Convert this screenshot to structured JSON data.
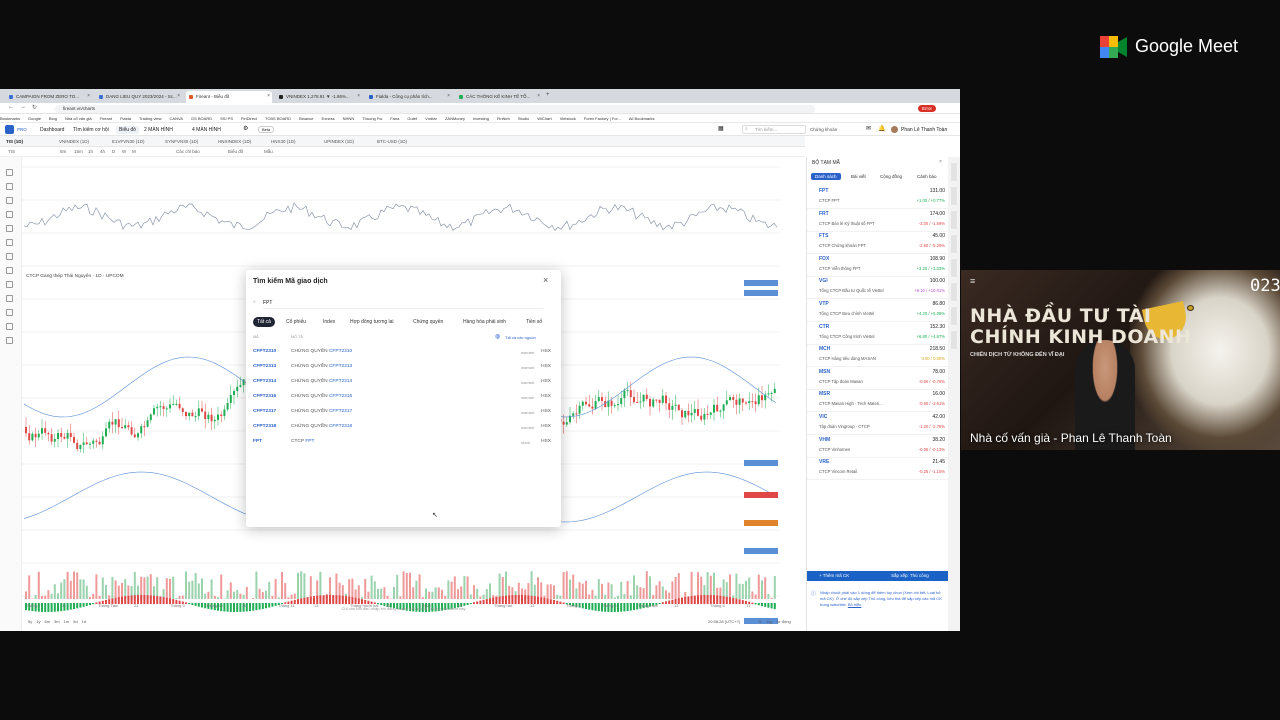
{
  "meet": {
    "brand": "Google Meet"
  },
  "browser": {
    "tabs": [
      {
        "label": "CAMPAIGN FROM ZERO TO..."
      },
      {
        "label": "DANG LIEU QUY 2023/2024 - Sc..."
      },
      {
        "label": "Fireant - Biểu đồ"
      },
      {
        "label": "VNINDEX 1,278.91 ▼ -1.86%..."
      },
      {
        "label": "Fialda - Công cụ phân tích..."
      },
      {
        "label": "CÁC THÔNG KẾ KINH TẾ TỔ..."
      }
    ],
    "url": "fireant.vn/charts",
    "error_btn": "Error",
    "bookmarks": [
      "Bookmarks",
      "Google",
      "Blog",
      "Nhà cổ vấn già",
      "Fireant",
      "Fialda",
      "Trading view",
      "CANVA",
      "GS BOARD",
      "SSI PS",
      "FinDirect",
      "TCBS BOARD",
      "Binance",
      "Exness",
      "NHNN",
      "Thuong Fw",
      "Fana",
      "Gutef",
      "Vndtar",
      "ZANMoney",
      "Investing",
      "FinNeh",
      "Studio",
      "WiChart",
      "Vietstock",
      "Forex Factory | For...",
      "All Bookmarks"
    ]
  },
  "app": {
    "logo": "PRO",
    "nav": [
      "Dashboard",
      "Tìm kiếm cơ hội",
      "Biểu đồ",
      "2 MÀN HÌNH",
      "4 MÀN HÌNH",
      "Beta"
    ],
    "search_placeholder": "Tìm kiếm...",
    "search_scope": "Chứng khoán",
    "user": "Phan Lê Thanh Toàn",
    "chart_tabs": [
      "TIS (1D)",
      "VNINDEX (1D)",
      "E1VFVN30 (1D)",
      "SYNFVN30 (1D)",
      "HNXINDEX (1D)",
      "HNX30 (1D)",
      "UPINDEX (1D)",
      "BTC-USD (1D)"
    ],
    "chart_tools": [
      "TIS",
      "5m",
      "15m",
      "1h",
      "4h",
      "D",
      "W",
      "M",
      "Các chỉ báo",
      "Biểu đồ",
      "Mẫu"
    ],
    "chart_title": "CTCP Gang thép Thái Nguyên · 1D · UPCOM",
    "x_labels": [
      "Tháng 7",
      "11",
      "Tháng Tám",
      "21",
      "Tháng 9",
      "Tháng 10",
      "16",
      "Tháng 11",
      "13",
      "Tháng mười hai",
      "11",
      "2024",
      "16",
      "Tháng hai",
      "13",
      "Tháng 3",
      "Tháng 4",
      "Tháng năm",
      "13",
      "Tháng 6",
      "17"
    ],
    "time_footer": "20:58:28 (UTC+7)",
    "footer_right": [
      "%",
      "log",
      "tự động"
    ],
    "periods": [
      "5y",
      "1y",
      "6m",
      "3m",
      "1m",
      "5d",
      "1d"
    ]
  },
  "watchlist": {
    "title": "BỘ TẠM MÃ",
    "tabs": [
      "Danh sách",
      "Bài viết",
      "Cộng đồng",
      "Cảnh báo"
    ],
    "items": [
      {
        "sym": "FPT",
        "name": "CTCP FPT",
        "price": "131.00",
        "chg": "+1.00 / +0.77%",
        "color": "#1fae55"
      },
      {
        "sym": "FRT",
        "name": "CTCP Bán lẻ Kỹ thuật số FPT",
        "price": "174.00",
        "chg": "-3.00 / -1.69%",
        "color": "#e04848"
      },
      {
        "sym": "FTS",
        "name": "CTCP Chứng khoán FPT",
        "price": "45.00",
        "chg": "-2.50 / -5.26%",
        "color": "#e04848"
      },
      {
        "sym": "FOX",
        "name": "CTCP Viễn thông FPT",
        "price": "108.90",
        "chg": "+3.20 / +3.03%",
        "color": "#1fae55"
      },
      {
        "sym": "VGI",
        "name": "Tổng CTCP Đầu tư Quốc tế Viettel",
        "price": "100.00",
        "chg": "+9.10 / +10.01%",
        "color": "#b84fd6"
      },
      {
        "sym": "VTP",
        "name": "Tổng CTCP Bưu chính Viettel",
        "price": "86.80",
        "chg": "+4.20 / +5.08%",
        "color": "#1fae55"
      },
      {
        "sym": "CTR",
        "name": "Tổng CTCP Công trình Viettel",
        "price": "152.30",
        "chg": "+6.80 / +4.67%",
        "color": "#1fae55"
      },
      {
        "sym": "MCH",
        "name": "CTCP Hàng tiêu dùng MASAN",
        "price": "218.50",
        "chg": "0.00 / 0.00%",
        "color": "#d6a51c"
      },
      {
        "sym": "MSN",
        "name": "CTCP Tập đoàn Masan",
        "price": "78.00",
        "chg": "-0.60 / -0.76%",
        "color": "#e04848"
      },
      {
        "sym": "MSR",
        "name": "CTCP Masan High - Tech Materi...",
        "price": "16.00",
        "chg": "-0.60 / -3.61%",
        "color": "#e04848"
      },
      {
        "sym": "VIC",
        "name": "Tập đoàn Vingroup - CTCP",
        "price": "42.00",
        "chg": "-1.20 / -2.78%",
        "color": "#e04848"
      },
      {
        "sym": "VHM",
        "name": "CTCP Vinhomes",
        "price": "38.20",
        "chg": "-0.05 / -0.13%",
        "color": "#e04848"
      },
      {
        "sym": "VRE",
        "name": "CTCP Vincom Retail",
        "price": "21.45",
        "chg": "-0.25 / -1.15%",
        "color": "#e04848"
      }
    ],
    "add_btn": "+ Thêm mã CK",
    "sort_btn": "Sắp xếp: Thủ công",
    "hint": "Nhấp chuột phải vào 1 dòng để thêm tùy chọn (Xem chi tiết, Loại bỏ mã CK). Ở chế độ sắp xếp Thủ công, kéo thả để sắp xếp các mã CK trong watchlist.",
    "hint_link": "Bỏ hiểu"
  },
  "modal": {
    "title": "Tìm kiếm Mã giao dịch",
    "query": "FPT",
    "filters": [
      "Tất cả",
      "Cổ phiếu",
      "Index",
      "Hợp đồng tương lai",
      "Chứng quyền",
      "Hàng hóa phái sinh",
      "Tiền số"
    ],
    "col_sym": "MÃ",
    "col_desc": "MÔ TẢ",
    "sources": "Tất cả các nguồn",
    "results": [
      {
        "sym": "CFPT2310",
        "desc": "CHỨNG QUYỀN",
        "code": "CFPT2310",
        "type": "warrant",
        "ex": "HSX"
      },
      {
        "sym": "CFPT2313",
        "desc": "CHỨNG QUYỀN",
        "code": "CFPT2313",
        "type": "warrant",
        "ex": "HSX"
      },
      {
        "sym": "CFPT2314",
        "desc": "CHỨNG QUYỀN",
        "code": "CFPT2314",
        "type": "warrant",
        "ex": "HSX"
      },
      {
        "sym": "CFPT2316",
        "desc": "CHỨNG QUYỀN",
        "code": "CFPT2316",
        "type": "warrant",
        "ex": "HSX"
      },
      {
        "sym": "CFPT2317",
        "desc": "CHỨNG QUYỀN",
        "code": "CFPT2317",
        "type": "warrant",
        "ex": "HSX"
      },
      {
        "sym": "CFPT2318",
        "desc": "CHỨNG QUYỀN",
        "code": "CFPT2318",
        "type": "warrant",
        "ex": "HSX"
      },
      {
        "sym": "FPT",
        "desc": "CTCP",
        "code": "FPT",
        "type": "stock",
        "ex": "HSX"
      }
    ],
    "footer": "Chỉ cần bắt đầu nhập khi đang ở trên biểu đồ để tìm hộp tìm kiếm này"
  },
  "video": {
    "overlay_line1": "NHÀ ĐẦU TƯ TÀI",
    "overlay_line2": "CHÍNH KINH DOANH",
    "overlay_sub": "CHIẾN DỊCH TỪ KHÔNG ĐẾN VĨ ĐẠI",
    "corner": "023",
    "participant": "Nhà cố vấn già - Phan Lê Thanh Toàn"
  }
}
